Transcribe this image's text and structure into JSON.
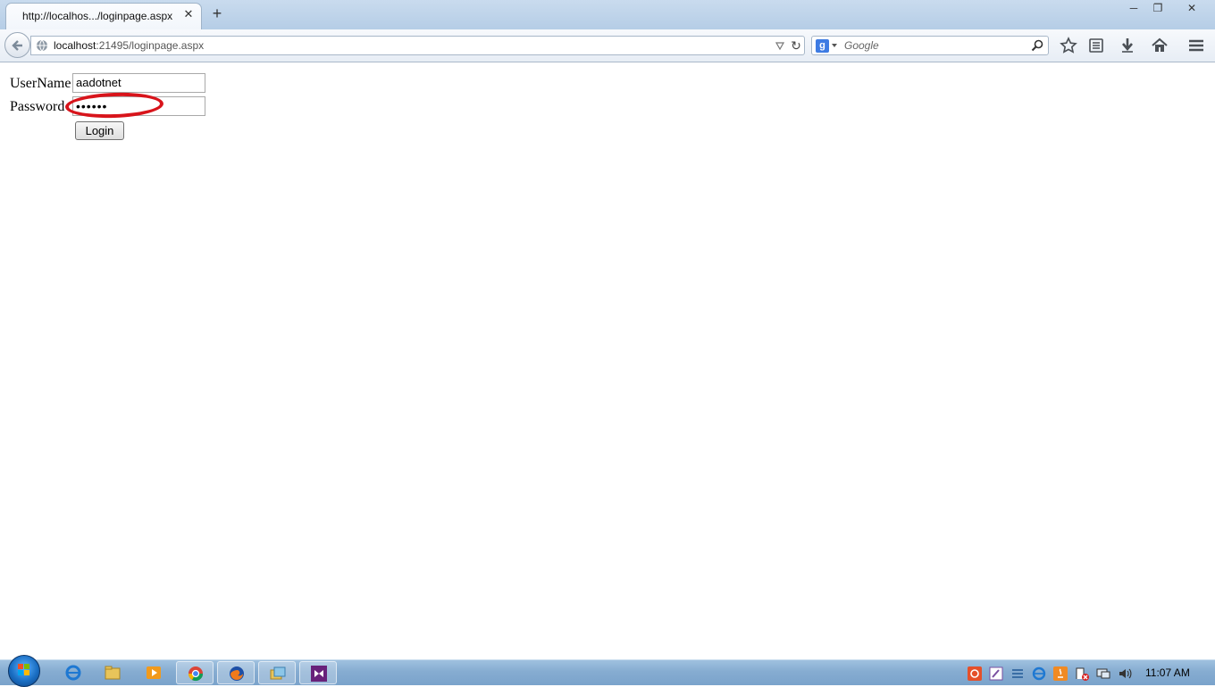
{
  "browser": {
    "tab_title": "http://localhos.../loginpage.aspx",
    "url_host": "localhost",
    "url_path": ":21495/loginpage.aspx",
    "search_placeholder": "Google",
    "search_engine_badge": "g"
  },
  "window_controls": [
    "minimize-icon",
    "restore-icon",
    "close-icon"
  ],
  "toolbar_icons": [
    "bookmark-star-icon",
    "reading-list-icon",
    "downloads-icon",
    "home-icon",
    "menu-icon"
  ],
  "login_form": {
    "username_label": "UserName",
    "username_value": "aadotnet",
    "password_label": "Password",
    "password_value": "••••••",
    "login_button": "Login"
  },
  "annotation_color": "#d8141b",
  "taskbar": {
    "pinned_apps": [
      "internet-explorer-icon",
      "windows-explorer-icon",
      "media-player-icon",
      "chrome-icon",
      "firefox-icon",
      "file-manager-icon",
      "visual-studio-icon"
    ],
    "tray_icons": [
      "record-icon",
      "paint-icon",
      "network-tool-icon",
      "ie-tray-icon",
      "java-icon",
      "action-center-icon",
      "network-icon",
      "volume-icon"
    ],
    "clock": "11:07 AM"
  }
}
